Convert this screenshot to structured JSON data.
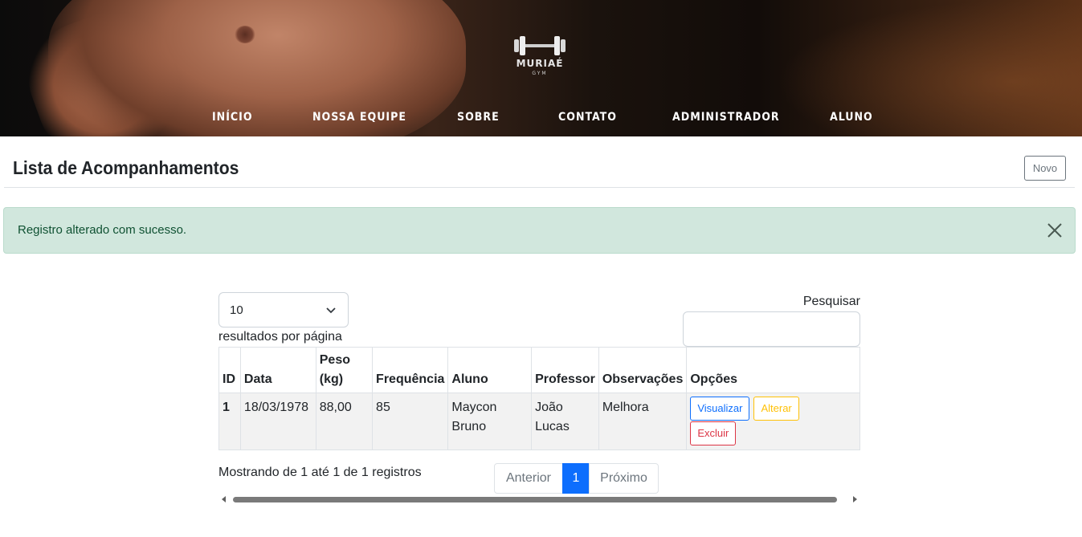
{
  "brand": {
    "name": "MURIAÉ",
    "sub": "GYM"
  },
  "nav": {
    "items": [
      {
        "label": "INÍCIO"
      },
      {
        "label": "NOSSA EQUIPE"
      },
      {
        "label": "SOBRE"
      },
      {
        "label": "CONTATO"
      },
      {
        "label": "ADMINISTRADOR"
      },
      {
        "label": "ALUNO"
      }
    ]
  },
  "page": {
    "title": "Lista de Acompanhamentos",
    "new_button": "Novo"
  },
  "alert": {
    "message": "Registro alterado com sucesso.",
    "close_icon": "close-icon"
  },
  "datatable": {
    "page_length": "10",
    "page_length_label": "resultados por página",
    "search_label": "Pesquisar",
    "search_value": "",
    "columns": [
      "ID",
      "Data",
      "Peso (kg)",
      "Frequência",
      "Aluno",
      "Professor",
      "Observações",
      "Opções"
    ],
    "rows": [
      {
        "id": "1",
        "data": "18/03/1978",
        "peso": "88,00",
        "frequencia": "85",
        "aluno": "Maycon Bruno",
        "professor": "João Lucas",
        "observacoes": "Melhora",
        "actions": {
          "view": "Visualizar",
          "edit": "Alterar",
          "delete": "Excluir"
        }
      }
    ],
    "info": "Mostrando de 1 até 1 de 1 registros",
    "pagination": {
      "previous": "Anterior",
      "current": "1",
      "next": "Próximo"
    }
  },
  "colors": {
    "primary": "#0d6efd",
    "warning": "#ffc107",
    "danger": "#dc3545",
    "alert_bg": "#d1e7dd",
    "alert_text": "#0f5132"
  }
}
